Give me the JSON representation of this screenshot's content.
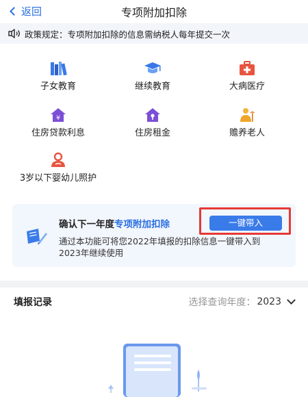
{
  "nav": {
    "back_label": "返回",
    "title": "专项附加扣除"
  },
  "notice": {
    "text": "政策规定：专项附加扣除的信息需纳税人每年提交一次"
  },
  "categories": [
    {
      "label": "子女教育",
      "icon": "books-icon"
    },
    {
      "label": "继续教育",
      "icon": "graduation-cap-icon"
    },
    {
      "label": "大病医疗",
      "icon": "first-aid-kit-icon"
    },
    {
      "label": "住房贷款利息",
      "icon": "house-yuan-icon"
    },
    {
      "label": "住房租金",
      "icon": "house-key-icon"
    },
    {
      "label": "赡养老人",
      "icon": "elderly-person-icon"
    },
    {
      "label": "3岁以下婴幼儿照护",
      "icon": "infant-care-icon"
    }
  ],
  "promo": {
    "title_prefix": "确认下一年度",
    "title_highlight": "专项附加扣除",
    "description": "通过本功能可将您2022年填报的扣除信息一键带入到2023年继续使用",
    "button_label": "一键带入"
  },
  "records": {
    "title": "填报记录",
    "year_select_label": "选择查询年度：",
    "year_value": "2023"
  },
  "colors": {
    "accent": "#2a6fe0",
    "button": "#3a7bea",
    "highlight_border": "#e53935"
  }
}
